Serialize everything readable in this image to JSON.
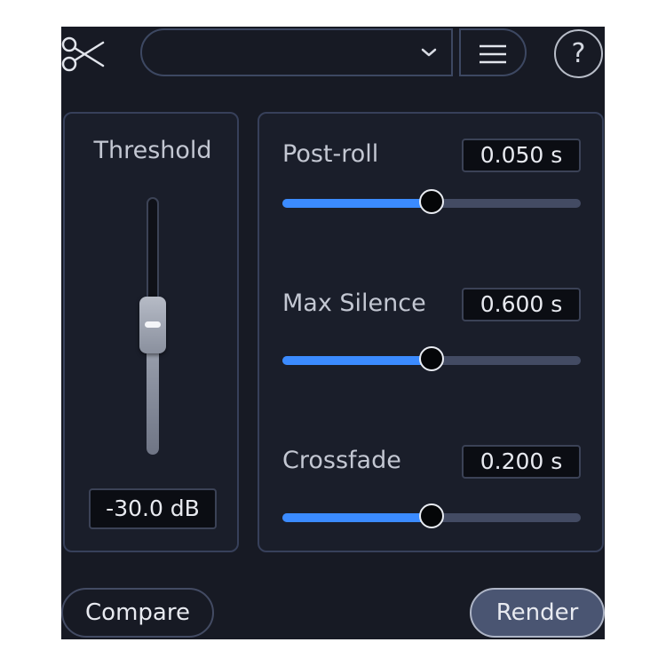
{
  "toolbar": {
    "scissors_icon": "scissors-icon",
    "preset_value": "",
    "preset_arrow_icon": "chevron-down-icon",
    "menu_icon": "hamburger-menu-icon",
    "help_label": "?"
  },
  "threshold": {
    "label": "Threshold",
    "value_text": "-30.0 dB",
    "fader_level": 0.55
  },
  "params": [
    {
      "label": "Post-roll",
      "value_text": "0.050 s",
      "level": 0.5
    },
    {
      "label": "Max Silence",
      "value_text": "0.600 s",
      "level": 0.5
    },
    {
      "label": "Crossfade",
      "value_text": "0.200 s",
      "level": 0.5
    }
  ],
  "footer": {
    "compare_label": "Compare",
    "render_label": "Render"
  },
  "colors": {
    "background": "#171a24",
    "panel_border": "#37405a",
    "accent_blue": "#3b8bff",
    "render_button": "#4a5572"
  }
}
